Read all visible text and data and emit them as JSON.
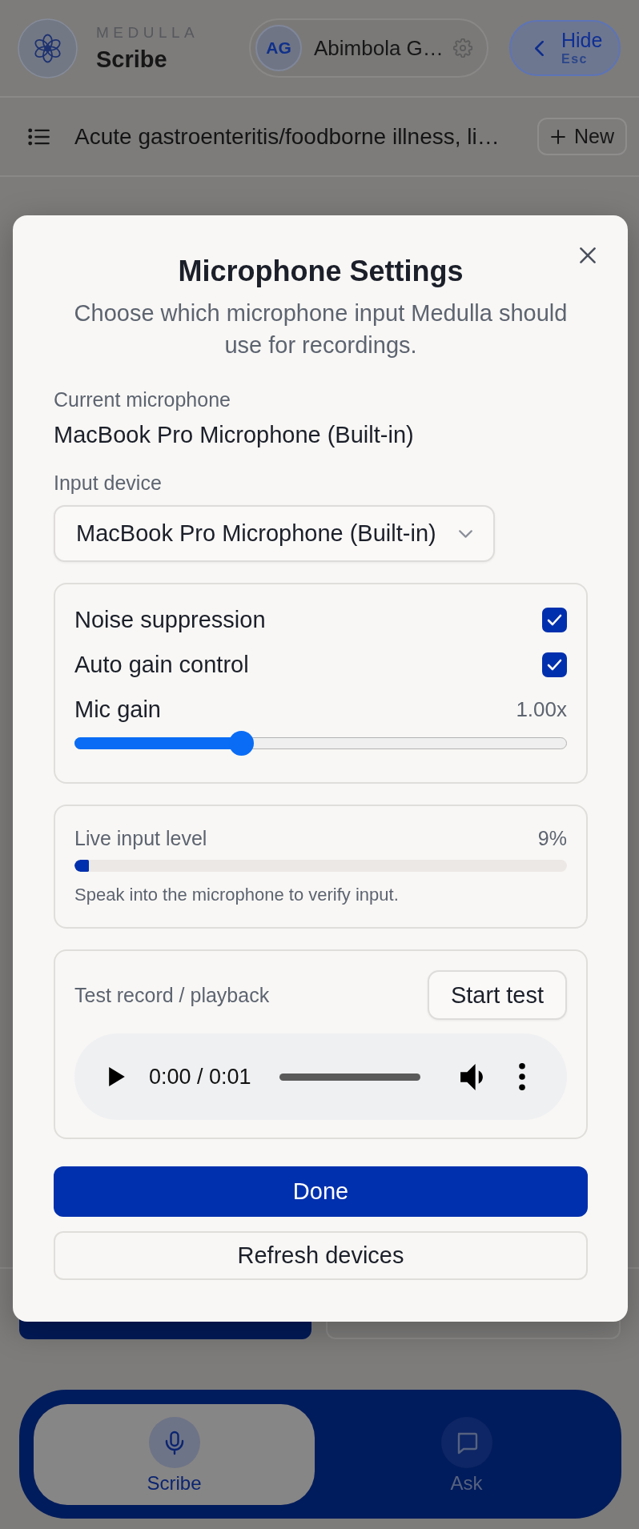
{
  "header": {
    "brand": {
      "overline": "MEDULLA",
      "name": "Scribe"
    },
    "user": {
      "initials": "AG",
      "name": "Abimbola G…"
    },
    "hide_button": {
      "label": "Hide",
      "shortcut": "Esc"
    }
  },
  "note_bar": {
    "title": "Acute gastroenteritis/foodborne illness, li…",
    "new_button": "New"
  },
  "dialog": {
    "title": "Microphone Settings",
    "description": "Choose which microphone input Medulla should use for recordings.",
    "current_label": "Current microphone",
    "current_value": "MacBook Pro Microphone (Built-in)",
    "input_label": "Input device",
    "input_value": "MacBook Pro Microphone (Built-in)",
    "options": [
      {
        "kind": "checkbox",
        "label": "Noise suppression",
        "checked": true
      },
      {
        "kind": "checkbox",
        "label": "Auto gain control",
        "checked": true
      },
      {
        "kind": "slider",
        "label": "Mic gain",
        "reading": "1.00x",
        "level": 0.33
      }
    ],
    "live_level": {
      "label": "Live input level",
      "reading": "9%",
      "level": 0.03,
      "hint": "Speak into the microphone to verify input."
    },
    "test": {
      "label": "Test record / playback",
      "button": "Start test",
      "player": {
        "time": "0:00 / 0:01"
      }
    },
    "buttons": [
      {
        "label": "Done",
        "kind": "primary"
      },
      {
        "label": "Refresh devices",
        "kind": "secondary"
      }
    ]
  },
  "bottom_nav": [
    {
      "label": "Scribe",
      "selected": true
    },
    {
      "label": "Ask",
      "selected": false
    }
  ]
}
